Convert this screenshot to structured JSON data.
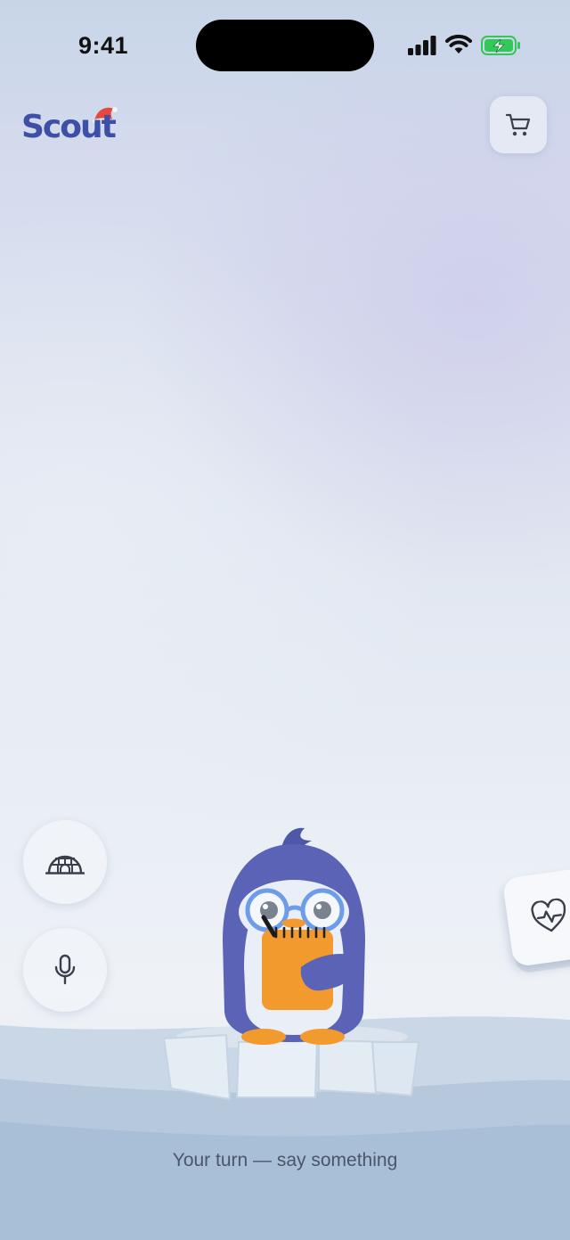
{
  "status_bar": {
    "time": "9:41"
  },
  "header": {
    "logo_text": "Scout",
    "cart_icon": "cart-icon"
  },
  "side_controls": {
    "igloo_icon": "igloo-icon",
    "mic_icon": "microphone-icon"
  },
  "health_card": {
    "icon": "heart-pulse-icon"
  },
  "prompt": {
    "text": "Your turn — say something"
  },
  "colors": {
    "brand_blue": "#3d4fa6",
    "brand_red": "#e5483f",
    "penguin_body": "#5a63b6",
    "penguin_belly": "#e9eef7",
    "accent_orange": "#f29a2e",
    "glasses_blue": "#6d9de8",
    "battery_green": "#34c759"
  }
}
